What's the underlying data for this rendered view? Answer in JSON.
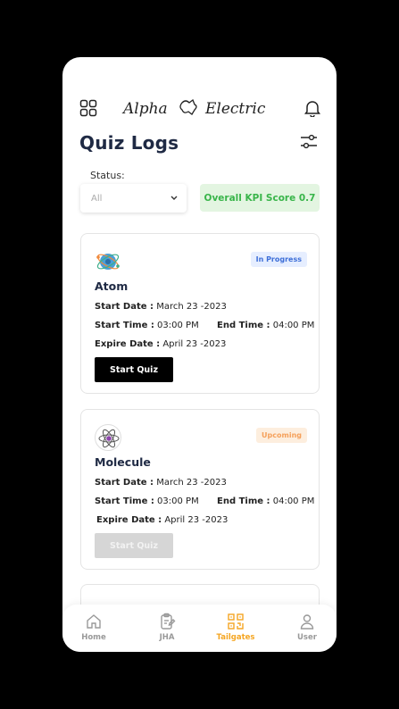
{
  "header": {
    "logo_text": "Alpha Electric",
    "title": "Quiz Logs"
  },
  "filters": {
    "status_label": "Status:",
    "status_value": "All",
    "kpi_text": "Overall KPI Score 0.7"
  },
  "quizzes": [
    {
      "title": "Atom",
      "badge": "In Progress",
      "start_date_label": "Start Date :",
      "start_date": "March 23 -2023",
      "start_time_label": "Start Time :",
      "start_time": "03:00 PM",
      "end_time_label": "End Time :",
      "end_time": "04:00 PM",
      "expire_date_label": "Expire Date :",
      "expire_date": "April 23 -2023",
      "button": "Start Quiz"
    },
    {
      "title": "Molecule",
      "badge": "Upcoming",
      "start_date_label": "Start Date :",
      "start_date": "March 23 -2023",
      "start_time_label": "Start Time :",
      "start_time": "03:00 PM",
      "end_time_label": "End Time :",
      "end_time": "04:00 PM",
      "expire_date_label": "Expire Date :",
      "expire_date": "April 23 -2023",
      "button": "Start Quiz"
    }
  ],
  "nav": [
    {
      "label": "Home",
      "icon": "home-icon"
    },
    {
      "label": "JHA",
      "icon": "clipboard-icon"
    },
    {
      "label": "Tailgates",
      "icon": "qr-icon",
      "active": true
    },
    {
      "label": "User",
      "icon": "user-icon"
    }
  ],
  "colors": {
    "accent": "#f5a623",
    "kpi_green": "#39b54a",
    "progress_blue": "#3e6fd8",
    "upcoming_orange": "#f5a05a"
  }
}
